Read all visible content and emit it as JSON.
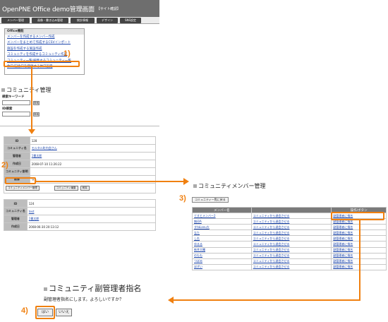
{
  "header": {
    "title": "OpenPNE Office demo管理画面",
    "subtitle": "【サイト確認】",
    "nav": [
      "メンバー管理",
      "画像・書き込み管理",
      "統計情報",
      "デザイン",
      "SNS設定"
    ]
  },
  "office_box": {
    "title": "Office機能",
    "links": [
      "メンバーを作成するメンバー作成",
      "メンバーをまとめて作成するCSVインポート",
      "施設を作成する施設作成",
      "コミュニティを作成するコミュニティ作成",
      "コミュニティ一覧/編集するコミュニティ一覧",
      "休日/記念日を登録する休日設定"
    ]
  },
  "community": {
    "heading": "コミュニティ管理",
    "search_keyword_label": "検索キーワード",
    "id_search_label": "ID検索",
    "search_btn": "検索",
    "records": [
      {
        "rows": [
          {
            "k": "ID",
            "v": "128"
          },
          {
            "k": "コミュニティ名",
            "v": "モルタル町内会さん"
          },
          {
            "k": "管理者",
            "v": "1番太郎"
          },
          {
            "k": "作成日",
            "v": "2008-07-10 11:26:22"
          },
          {
            "k": "コミュニティ説明",
            "v": ""
          },
          {
            "k": "画像",
            "v": "なし"
          }
        ],
        "actions": [
          "コミュニティメンバー管理",
          "コミュニティ編集",
          "削除"
        ]
      },
      {
        "rows": [
          {
            "k": "ID",
            "v": "124"
          },
          {
            "k": "コミュニティ名",
            "v": "test"
          },
          {
            "k": "管理者",
            "v": "1番太郎"
          },
          {
            "k": "作成日",
            "v": "2008-06-30 20:13:12"
          }
        ]
      }
    ]
  },
  "members": {
    "heading": "コミュニティメンバー管理",
    "back_btn": "コミュニティ一覧に戻る",
    "columns": [
      "メンバー名",
      "",
      "操作/ボタン"
    ],
    "rows": [
      [
        "てすとメンバー2",
        "コミュニティから退会させる",
        "副管理者に指名"
      ],
      [
        "無印A",
        "コミュニティから退会させる",
        "副管理者に指名"
      ],
      [
        "すtaLanu大",
        "コミュニティから退会させる",
        "副管理者に指名"
      ],
      [
        "なた",
        "コミュニティから退会させる",
        "副管理者に指名"
      ],
      [
        "しれ",
        "コミュニティから退会させる",
        "副管理者に指名"
      ],
      [
        "ゆるる",
        "コミュニティから退会させる",
        "副管理者に指名"
      ],
      [
        "新井大輔",
        "コミュニティから退会させる",
        "副管理者に指名"
      ],
      [
        "のもも",
        "コミュニティから退会させる",
        "副管理者に指名"
      ],
      [
        "つぼみ",
        "コミュニティから退会させる",
        "副管理者に指名"
      ],
      [
        "ほずい",
        "コミュニティから退会させる",
        "副管理者に指名"
      ]
    ]
  },
  "dialog": {
    "heading": "コミュニティ副管理者指名",
    "message": "副管理者指名にします。よろしいですか？",
    "yes": "はい",
    "no": "いいえ"
  },
  "steps": [
    "1)",
    "2)",
    "3)",
    "4)"
  ],
  "colors": {
    "annotation": "#f08010",
    "link": "#1a44aa",
    "header": "#6e6e6e"
  }
}
